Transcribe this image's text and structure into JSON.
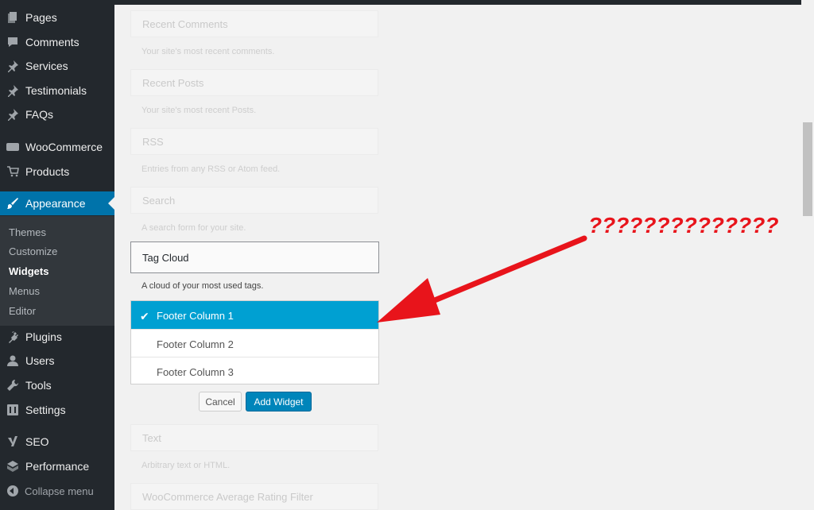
{
  "sidebar": {
    "items": [
      {
        "label": "Pages",
        "icon": "pages-icon"
      },
      {
        "label": "Comments",
        "icon": "comments-icon"
      },
      {
        "label": "Services",
        "icon": "pin-icon"
      },
      {
        "label": "Testimonials",
        "icon": "pin-icon"
      },
      {
        "label": "FAQs",
        "icon": "pin-icon"
      },
      {
        "label": "WooCommerce",
        "icon": "woocommerce-icon"
      },
      {
        "label": "Products",
        "icon": "cart-icon"
      },
      {
        "label": "Appearance",
        "icon": "paintbrush-icon"
      },
      {
        "label": "Plugins",
        "icon": "plug-icon"
      },
      {
        "label": "Users",
        "icon": "users-icon"
      },
      {
        "label": "Tools",
        "icon": "wrench-icon"
      },
      {
        "label": "Settings",
        "icon": "settings-icon"
      },
      {
        "label": "SEO",
        "icon": "yoast-icon"
      },
      {
        "label": "Performance",
        "icon": "performance-icon"
      }
    ],
    "submenu": [
      "Themes",
      "Customize",
      "Widgets",
      "Menus",
      "Editor"
    ],
    "collapse_label": "Collapse menu"
  },
  "widgets": {
    "list": [
      {
        "title": "Recent Comments",
        "desc": "Your site's most recent comments."
      },
      {
        "title": "Recent Posts",
        "desc": "Your site's most recent Posts."
      },
      {
        "title": "RSS",
        "desc": "Entries from any RSS or Atom feed."
      },
      {
        "title": "Search",
        "desc": "A search form for your site."
      },
      {
        "title": "Tag Cloud",
        "desc": "A cloud of your most used tags."
      },
      {
        "title": "Text",
        "desc": "Arbitrary text or HTML."
      },
      {
        "title": "WooCommerce Average Rating Filter",
        "desc": ""
      }
    ],
    "chooser": [
      "Footer Column 1",
      "Footer Column 2",
      "Footer Column 3"
    ],
    "cancel_label": "Cancel",
    "add_label": "Add Widget"
  },
  "annotation": {
    "text": "??????????????",
    "color": "#e8141b"
  },
  "colors": {
    "sidebar_bg": "#23282d",
    "active_bg": "#0073aa",
    "selected_bg": "#00a0d2",
    "primary_button": "#0085ba"
  }
}
